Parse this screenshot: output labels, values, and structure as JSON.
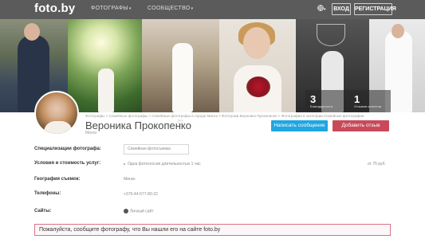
{
  "header": {
    "logo": "foto.by",
    "nav": [
      {
        "label": "ФОТОГРАФЫ"
      },
      {
        "label": "СООБЩЕСТВО"
      }
    ],
    "login_label": "ВХОД",
    "register_label": "РЕГИСТРАЦИЯ"
  },
  "cover": {
    "stats": [
      {
        "value": "3",
        "label": "Благодарности"
      },
      {
        "value": "1",
        "label": "Отзывов клиентов"
      }
    ]
  },
  "breadcrumb": "Фотографы > Семейные фотографы > Семейные фотографы в городе Минск > Фотограф Вероника Прокопенко > Фотография в категории Семейные фотографии",
  "profile": {
    "name": "Вероника Прокопенко",
    "city": "Минск",
    "contact_label": "Написать сообщение",
    "review_label": "Добавить отзыв"
  },
  "info": {
    "specialization_label": "Специализации фотографа:",
    "specialization_value": "Семейная фотосъемка",
    "terms_label": "Условия и стоимость услуг:",
    "terms_item": "Одна фотосессия длительностью 1 час",
    "terms_price": "от 75 руб.",
    "geography_label": "География съемок:",
    "geography_value": "Минск",
    "phones_label": "Телефоны:",
    "phones_value": "+375-44-577-80-22",
    "sites_label": "Сайты:",
    "sites_value": "Личный сайт"
  },
  "notice": "Пожалуйста, сообщите фотографу, что Вы нашли его на сайте foto.by",
  "colors": {
    "topbar": "#5b5b5b",
    "contact_button": "#1fa6e0",
    "review_button": "#c84a5a",
    "notice_border": "#d6738a"
  }
}
